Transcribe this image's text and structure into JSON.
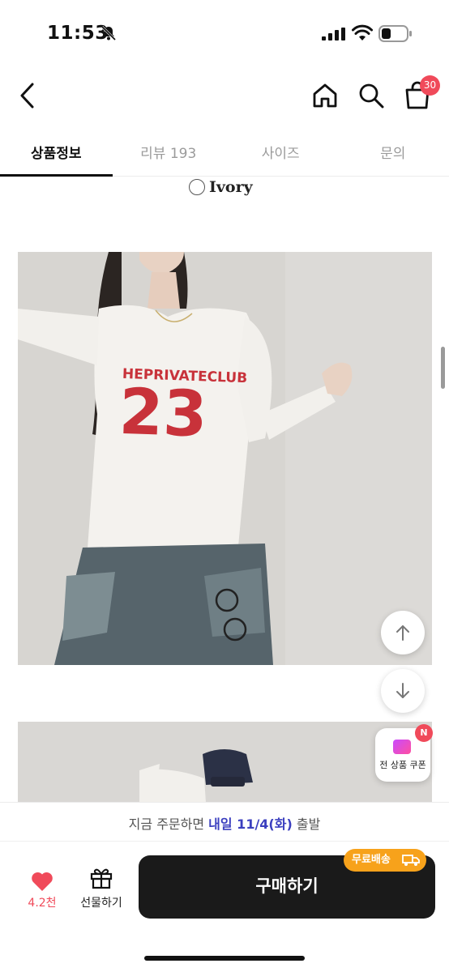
{
  "status_bar": {
    "time": "11:53"
  },
  "header": {
    "cart_count": "30"
  },
  "tabs": [
    {
      "label": "상품정보",
      "active": true
    },
    {
      "label": "리뷰 193",
      "active": false
    },
    {
      "label": "사이즈",
      "active": false
    },
    {
      "label": "문의",
      "active": false
    }
  ],
  "content": {
    "color_option": "Ivory",
    "shirt_print_line1": "HEPRIVATECLUB",
    "shirt_print_line2": "23"
  },
  "floating": {
    "coupon_label": "전 상품 쿠폰",
    "coupon_badge": "N"
  },
  "bottom_bar": {
    "ship_prefix": "지금 주문하면 ",
    "ship_highlight": "내일 11/4(화)",
    "ship_suffix": " 출발",
    "like_count": "4.2천",
    "gift_label": "선물하기",
    "buy_label": "구매하기",
    "free_shipping_label": "무료배송"
  },
  "colors": {
    "accent_red": "#f04a5a",
    "buy_button": "#1a1a1a",
    "free_shipping": "#f7a21b",
    "ship_highlight": "#3b3fbf"
  },
  "icons": {
    "back": "chevron-left-icon",
    "home": "home-icon",
    "search": "search-icon",
    "cart": "shopping-bag-icon",
    "scroll_up": "arrow-up-icon",
    "scroll_down": "arrow-down-icon",
    "like": "heart-icon",
    "gift": "gift-icon",
    "truck": "truck-icon"
  }
}
